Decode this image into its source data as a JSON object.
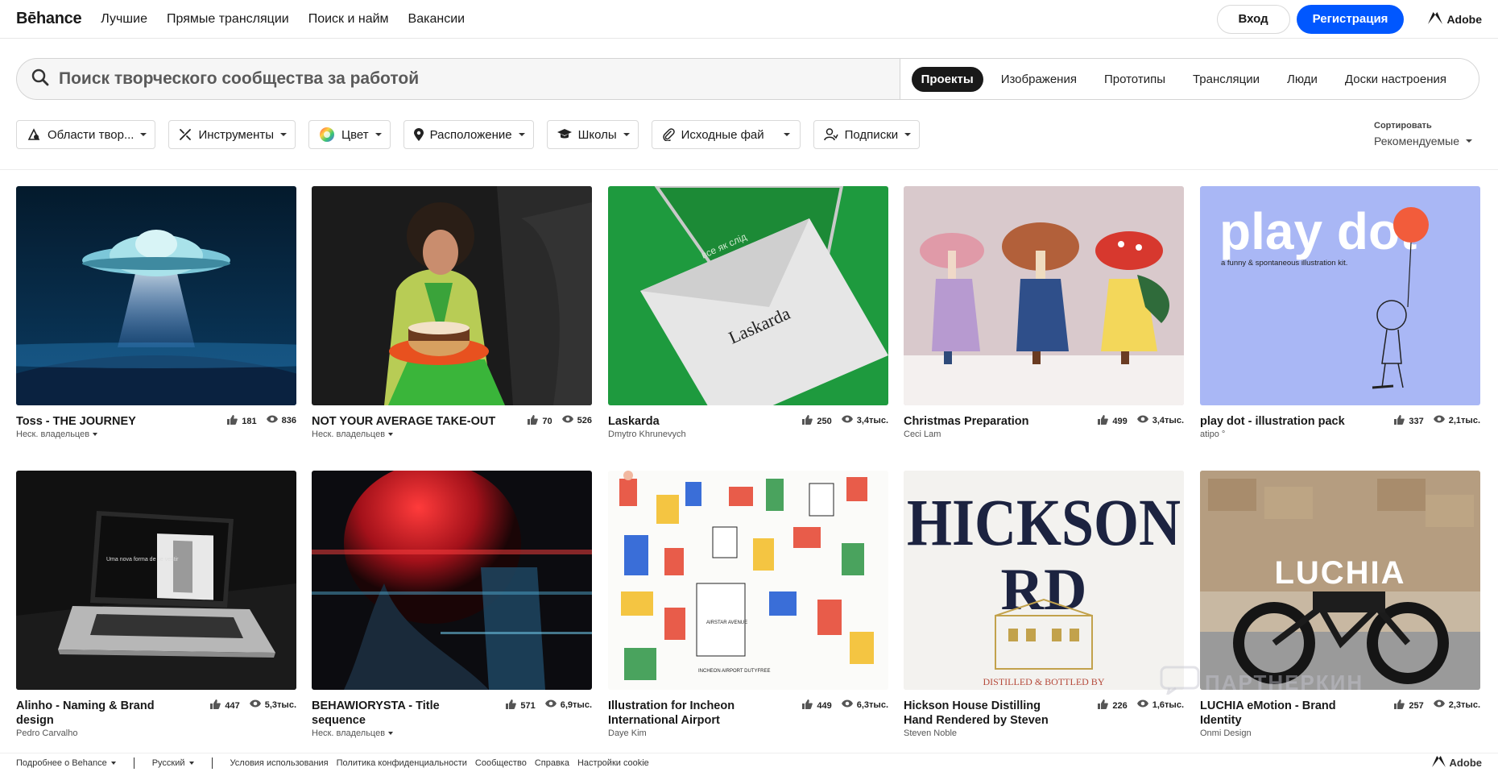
{
  "nav": {
    "logo": "Bēhance",
    "items": [
      "Лучшие",
      "Прямые трансляции",
      "Поиск и найм",
      "Вакансии"
    ],
    "login": "Вход",
    "signup": "Регистрация",
    "adobe": "Adobe",
    "accent": "#0057ff"
  },
  "search": {
    "placeholder": "Поиск творческого сообщества за работой",
    "tabs": [
      "Проекты",
      "Изображения",
      "Прототипы",
      "Трансляции",
      "Люди",
      "Доски настроения"
    ],
    "active_tab": "Проекты"
  },
  "filters": [
    {
      "label": "Области твор...",
      "icon": "creative-fields-icon"
    },
    {
      "label": "Инструменты",
      "icon": "tools-icon"
    },
    {
      "label": "Цвет",
      "icon": "color-wheel-icon"
    },
    {
      "label": "Расположение",
      "icon": "location-pin-icon"
    },
    {
      "label": "Школы",
      "icon": "school-cap-icon"
    },
    {
      "label": "Исходные фай",
      "icon": "paperclip-icon"
    },
    {
      "label": "Подписки",
      "icon": "subscriptions-icon"
    }
  ],
  "sort": {
    "label": "Сортировать",
    "value": "Рекомендуемые"
  },
  "projects": [
    {
      "title": "Toss - THE JOURNEY",
      "owner": "Неск. владельцев",
      "owner_dropdown": true,
      "likes": "181",
      "views": "836"
    },
    {
      "title": "NOT YOUR AVERAGE TAKE-OUT",
      "owner": "Неск. владельцев",
      "owner_dropdown": true,
      "likes": "70",
      "views": "526"
    },
    {
      "title": "Laskarda",
      "owner": "Dmytro Khrunevych",
      "owner_dropdown": false,
      "likes": "250",
      "views": "3,4тыс.",
      "image_text": "все як слід",
      "image_text2": "Laskarda"
    },
    {
      "title": "Christmas Preparation",
      "owner": "Ceci Lam",
      "owner_dropdown": false,
      "likes": "499",
      "views": "3,4тыс."
    },
    {
      "title": "play dot - illustration pack",
      "owner": "atipo °",
      "owner_dropdown": false,
      "likes": "337",
      "views": "2,1тыс.",
      "image_text": "play dot",
      "image_text2": "a funny & spontaneous illustration kit."
    },
    {
      "title": "Alinho - Naming & Brand design",
      "owner": "Pedro Carvalho",
      "owner_dropdown": false,
      "likes": "447",
      "views": "5,3тыс.",
      "image_text": "Uma nova forma de se vestir"
    },
    {
      "title": "BEHAWIORYSTA - Title sequence",
      "owner": "Неск. владельцев",
      "owner_dropdown": true,
      "likes": "571",
      "views": "6,9тыс."
    },
    {
      "title": "Illustration for Incheon International Airport",
      "owner": "Daye Kim",
      "owner_dropdown": false,
      "likes": "449",
      "views": "6,3тыс.",
      "image_text": "AIRSTAR AVENUE",
      "image_text2": "INCHEON AIRPORT DUTYFREE"
    },
    {
      "title": "Hickson House Distilling Hand Rendered by Steven",
      "owner": "Steven Noble",
      "owner_dropdown": false,
      "likes": "226",
      "views": "1,6тыс.",
      "image_text": "HICKSON",
      "image_text2": "RD",
      "image_text3": "DISTILLED & BOTTLED BY"
    },
    {
      "title": "LUCHIA eMotion - Brand Identity",
      "owner": "Onmi Design",
      "owner_dropdown": false,
      "likes": "257",
      "views": "2,3тыс.",
      "image_text": "LUCHIA"
    }
  ],
  "footer": {
    "more": "Подробнее о Behance",
    "language": "Русский",
    "links": [
      "Условия использования",
      "Политика конфиденциальности",
      "Сообщество",
      "Справка",
      "Настройки cookie"
    ],
    "adobe": "Adobe"
  },
  "watermark": "ПАРТНЕРКИН"
}
